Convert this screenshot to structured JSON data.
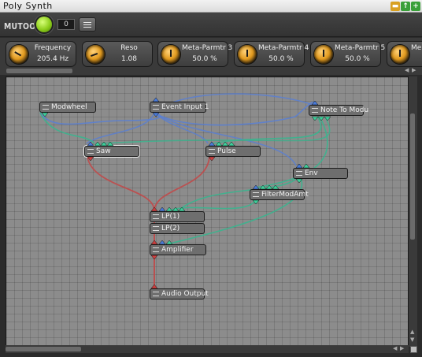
{
  "window": {
    "title": "Poly Synth"
  },
  "toolbar": {
    "logo": "MUTOOLS",
    "counter": "0"
  },
  "knobs": [
    {
      "name": "Frequency",
      "value": "205.4 Hz"
    },
    {
      "name": "Reso",
      "value": "1.08"
    },
    {
      "name": "Meta-Parmtr 3",
      "value": "50.0 %"
    },
    {
      "name": "Meta-Parmtr 4",
      "value": "50.0 %"
    },
    {
      "name": "Meta-Parmtr 5",
      "value": "50.0 %"
    },
    {
      "name": "Me",
      "value": ""
    }
  ],
  "nodes": {
    "modwheel": "Modwheel",
    "event_input": "Event Input 1",
    "note_to_modu": "Note To Modu",
    "saw": "Saw",
    "pulse": "Pulse",
    "env": "Env",
    "filtermodamt": "FilterModAmt",
    "lp1": "LP(1)",
    "lp2": "LP(2)",
    "amplifier": "Amplifier",
    "audio_output": "Audio Output"
  },
  "colors": {
    "audio_wire": "#c04a4a",
    "event_wire": "#5b7fd0",
    "mod_wire": "#39b58e"
  }
}
